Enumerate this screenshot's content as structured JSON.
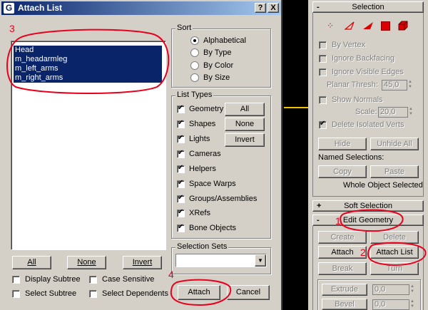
{
  "dialog": {
    "title": "Attach List",
    "title_buttons": [
      "?",
      "X"
    ],
    "objects": [
      "Head",
      "m_headarmleg",
      "m_left_arms",
      "m_right_arms"
    ],
    "list_buttons": {
      "all": "All",
      "none": "None",
      "invert": "Invert"
    },
    "checkboxes": {
      "display_subtree": "Display Subtree",
      "case_sensitive": "Case Sensitive",
      "select_subtree": "Select Subtree",
      "select_dependents": "Select Dependents"
    },
    "sort": {
      "label": "Sort",
      "options": [
        "Alphabetical",
        "By Type",
        "By Color",
        "By Size"
      ],
      "selected": "Alphabetical"
    },
    "list_types": {
      "label": "List Types",
      "items": [
        "Geometry",
        "Shapes",
        "Lights",
        "Cameras",
        "Helpers",
        "Space Warps",
        "Groups/Assemblies",
        "XRefs",
        "Bone Objects"
      ],
      "all": "All",
      "none": "None",
      "invert": "Invert"
    },
    "selection_sets": {
      "label": "Selection Sets",
      "value": ""
    },
    "attach": "Attach",
    "cancel": "Cancel"
  },
  "panel": {
    "selection_header": "Selection",
    "by_vertex": "By Vertex",
    "ignore_backfacing": "Ignore Backfacing",
    "ignore_visible_edges": "Ignore Visible Edges",
    "planar_thresh_label": "Planar Thresh:",
    "planar_thresh_value": "45,0",
    "show_normals": "Show Normals",
    "scale_label": "Scale:",
    "scale_value": "20,0",
    "delete_isolated": "Delete Isolated Verts",
    "hide": "Hide",
    "unhide_all": "Unhide All",
    "named_selections": "Named Selections:",
    "copy": "Copy",
    "paste": "Paste",
    "whole_object": "Whole Object Selected",
    "soft_selection": "Soft Selection",
    "edit_geometry": "Edit Geometry",
    "create": "Create",
    "delete": "Delete",
    "attach": "Attach",
    "attach_list": "Attach List",
    "break": "Break",
    "turn": "Turn",
    "extrude": "Extrude",
    "extrude_value": "0,0",
    "bevel": "Bevel",
    "bevel_value": "0,0",
    "plus": "+",
    "minus": "-"
  },
  "annotations": [
    "1",
    "2",
    "3",
    "4"
  ]
}
